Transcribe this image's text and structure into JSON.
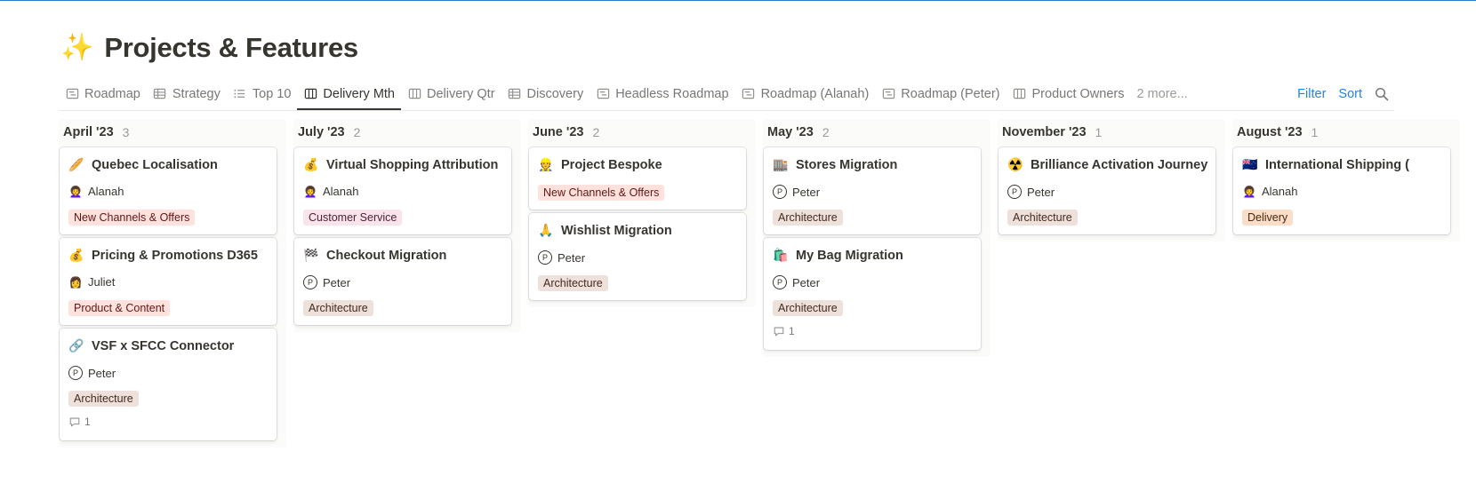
{
  "page": {
    "title_emoji": "✨",
    "title": "Projects & Features"
  },
  "tabs": [
    {
      "label": "Roadmap",
      "icon": "timeline-icon"
    },
    {
      "label": "Strategy",
      "icon": "table-icon"
    },
    {
      "label": "Top 10",
      "icon": "list-icon"
    },
    {
      "label": "Delivery Mth",
      "icon": "board-icon",
      "active": true
    },
    {
      "label": "Delivery Qtr",
      "icon": "board-icon"
    },
    {
      "label": "Discovery",
      "icon": "table-icon"
    },
    {
      "label": "Headless Roadmap",
      "icon": "timeline-icon"
    },
    {
      "label": "Roadmap (Alanah)",
      "icon": "timeline-icon"
    },
    {
      "label": "Roadmap (Peter)",
      "icon": "timeline-icon"
    },
    {
      "label": "Product Owners",
      "icon": "board-icon"
    }
  ],
  "more_tabs_label": "2 more...",
  "actions": {
    "filter": "Filter",
    "sort": "Sort"
  },
  "colors": {
    "accent": "#2383e2",
    "top_border": "#2a7bd4"
  },
  "columns": [
    {
      "title": "April '23",
      "count": "3",
      "cards": [
        {
          "emoji": "🥖",
          "title": "Quebec Localisation",
          "person_icon": "👩‍🦱",
          "person": "Alanah",
          "tag": "New Channels & Offers",
          "tag_color": "red"
        },
        {
          "emoji": "💰",
          "title": "Pricing & Promotions D365",
          "person_icon": "👩",
          "person": "Juliet",
          "tag": "Product & Content",
          "tag_color": "red"
        },
        {
          "emoji": "🔗",
          "title": "VSF x SFCC Connector",
          "person_letter": "P",
          "person": "Peter",
          "tag": "Architecture",
          "tag_color": "brown",
          "comments": "1"
        }
      ]
    },
    {
      "title": "July '23",
      "count": "2",
      "cards": [
        {
          "emoji": "💰",
          "title": "Virtual Shopping Attribution",
          "person_icon": "👩‍🦱",
          "person": "Alanah",
          "tag": "Customer Service",
          "tag_color": "pink"
        },
        {
          "emoji": "🏁",
          "title": "Checkout Migration",
          "person_letter": "P",
          "person": "Peter",
          "tag": "Architecture",
          "tag_color": "brown"
        }
      ]
    },
    {
      "title": "June '23",
      "count": "2",
      "cards": [
        {
          "emoji": "👷",
          "title": "Project Bespoke",
          "tag": "New Channels & Offers",
          "tag_color": "red"
        },
        {
          "emoji": "🙏",
          "title": "Wishlist Migration",
          "person_letter": "P",
          "person": "Peter",
          "tag": "Architecture",
          "tag_color": "brown"
        }
      ]
    },
    {
      "title": "May '23",
      "count": "2",
      "cards": [
        {
          "emoji": "🏬",
          "title": "Stores Migration",
          "person_letter": "P",
          "person": "Peter",
          "tag": "Architecture",
          "tag_color": "brown"
        },
        {
          "emoji": "🛍️",
          "title": "My Bag Migration",
          "person_letter": "P",
          "person": "Peter",
          "tag": "Architecture",
          "tag_color": "brown",
          "comments": "1"
        }
      ]
    },
    {
      "title": "November '23",
      "count": "1",
      "cards": [
        {
          "emoji": "☢️",
          "title": "Brilliance Activation Journey",
          "person_letter": "P",
          "person": "Peter",
          "tag": "Architecture",
          "tag_color": "brown"
        }
      ]
    },
    {
      "title": "August '23",
      "count": "1",
      "cards": [
        {
          "emoji": "🇳🇿",
          "title": "International Shipping (",
          "person_icon": "👩‍🦱",
          "person": "Alanah",
          "tag": "Delivery",
          "tag_color": "orange"
        }
      ]
    }
  ]
}
